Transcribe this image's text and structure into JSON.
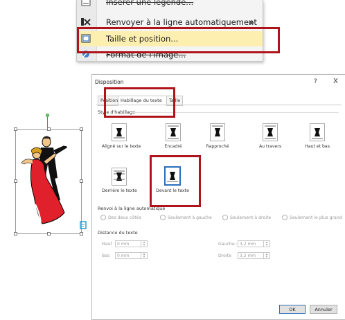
{
  "context_menu": {
    "items": [
      {
        "label": "Insérer une légende...",
        "icon": "caption-icon"
      },
      {
        "label": "Renvoyer à la ligne automatiquement",
        "icon": "text-wrap-icon",
        "has_submenu": true
      },
      {
        "label": "Taille et position...",
        "icon": "size-position-icon",
        "highlighted": true
      },
      {
        "label": "Format de l'image...",
        "icon": "format-picture-icon"
      }
    ]
  },
  "dialog": {
    "title": "Disposition",
    "help": "?",
    "close": "X",
    "tabs": [
      "Position",
      "Habillage du texte",
      "Taille"
    ],
    "active_tab": "Habillage du texte",
    "wrap_style_title": "Style d'habillage",
    "wrap_styles": [
      "Aligné sur le texte",
      "Encadré",
      "Rapproché",
      "Au travers",
      "Haut et bas",
      "Derrière le texte",
      "Devant le texte"
    ],
    "selected_style": "Devant le texte",
    "wrap_text_title": "Renvoi à la ligne automatique",
    "wrap_text_options": [
      "Des deux côtés",
      "Seulement à gauche",
      "Seulement à droite",
      "Seulement le plus grand"
    ],
    "distance_title": "Distance du texte",
    "distance": {
      "haut_label": "Haut",
      "haut_value": "0 mm",
      "bas_label": "Bas",
      "bas_value": "0 mm",
      "gauche_label": "Gauche :",
      "gauche_value": "3,2 mm",
      "droite_label": "Droite",
      "droite_value": "3,2 mm"
    },
    "ok": "OK",
    "cancel": "Annuler"
  },
  "colors": {
    "highlight_box": "#b0141b",
    "menu_highlight": "#fcefb0",
    "selected_blue": "#2a6ebb",
    "dancer_red": "#e0202a"
  }
}
